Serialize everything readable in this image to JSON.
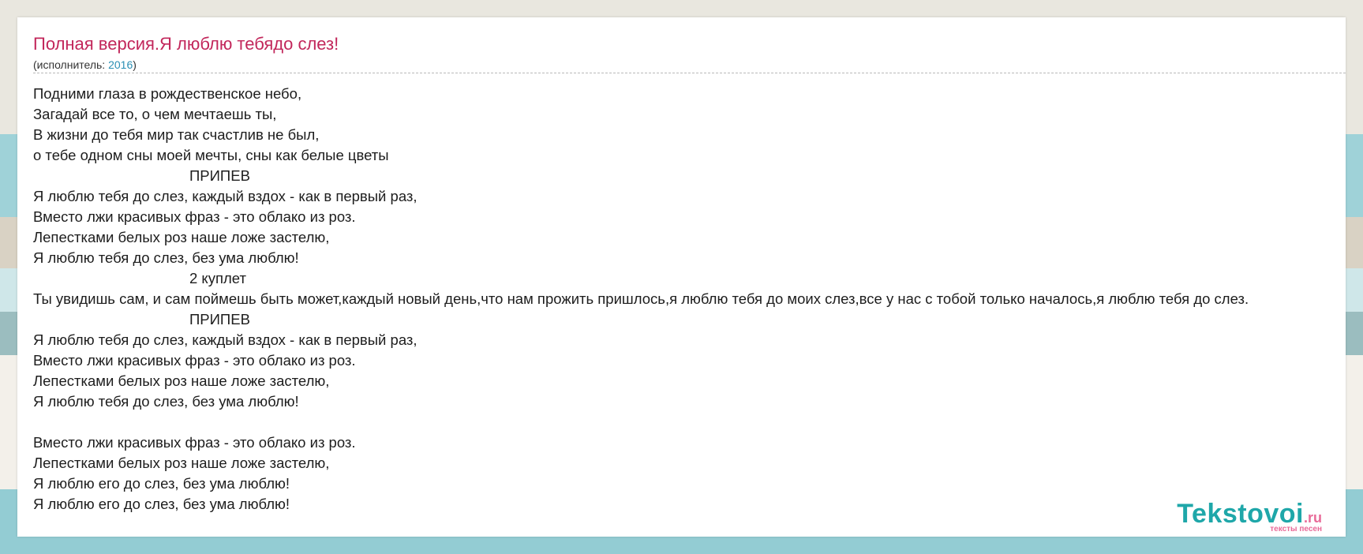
{
  "song": {
    "title": "Полная версия.Я люблю тебядо слез!",
    "performer_prefix": "(исполнитель: ",
    "performer_link": "2016",
    "performer_suffix": ")"
  },
  "lyrics": {
    "lines": [
      {
        "text": "Подними глаза в рождественское небо,",
        "center": false
      },
      {
        "text": "Загадай все то, о чем мечтаешь ты,",
        "center": false
      },
      {
        "text": "В жизни до тебя мир так счастлив не был,",
        "center": false
      },
      {
        "text": "о тебе одном сны моей мечты, сны как белые цветы",
        "center": false
      },
      {
        "text": "ПРИПЕВ",
        "center": true
      },
      {
        "text": "Я люблю тебя до слез, каждый вздох - как в первый раз,",
        "center": false
      },
      {
        "text": "Вместо лжи красивых фраз - это облако из роз.",
        "center": false
      },
      {
        "text": "Лепестками белых роз наше ложе застелю,",
        "center": false
      },
      {
        "text": "Я люблю тебя до слез, без ума люблю!",
        "center": false
      },
      {
        "text": "2 куплет",
        "center": true
      },
      {
        "text": "Ты увидишь сам, и сам поймешь быть может,каждый новый день,что нам прожить пришлось,я люблю тебя до моих слез,все у нас с тобой только началось,я люблю тебя до слез.",
        "center": false
      },
      {
        "text": "ПРИПЕВ",
        "center": true
      },
      {
        "text": "Я люблю тебя до слез, каждый вздох - как в первый раз,",
        "center": false
      },
      {
        "text": "Вместо лжи красивых фраз - это облако из роз.",
        "center": false
      },
      {
        "text": "Лепестками белых роз наше ложе застелю,",
        "center": false
      },
      {
        "text": "Я люблю тебя до слез, без ума люблю!",
        "center": false
      },
      {
        "text": "",
        "center": false
      },
      {
        "text": "Вместо лжи красивых фраз - это облако из роз.",
        "center": false
      },
      {
        "text": "Лепестками белых роз наше ложе застелю,",
        "center": false
      },
      {
        "text": "Я люблю его до слез, без ума люблю!",
        "center": false
      },
      {
        "text": "Я люблю его до слез, без ума люблю!",
        "center": false
      }
    ]
  },
  "logo": {
    "main": "Tekstovoi",
    "tld": ".ru",
    "tagline": "тексты песен"
  },
  "colors": {
    "title": "#c2275b",
    "link": "#2a8fb4",
    "logo_main": "#1fa7a9",
    "logo_accent": "#e96a98"
  }
}
